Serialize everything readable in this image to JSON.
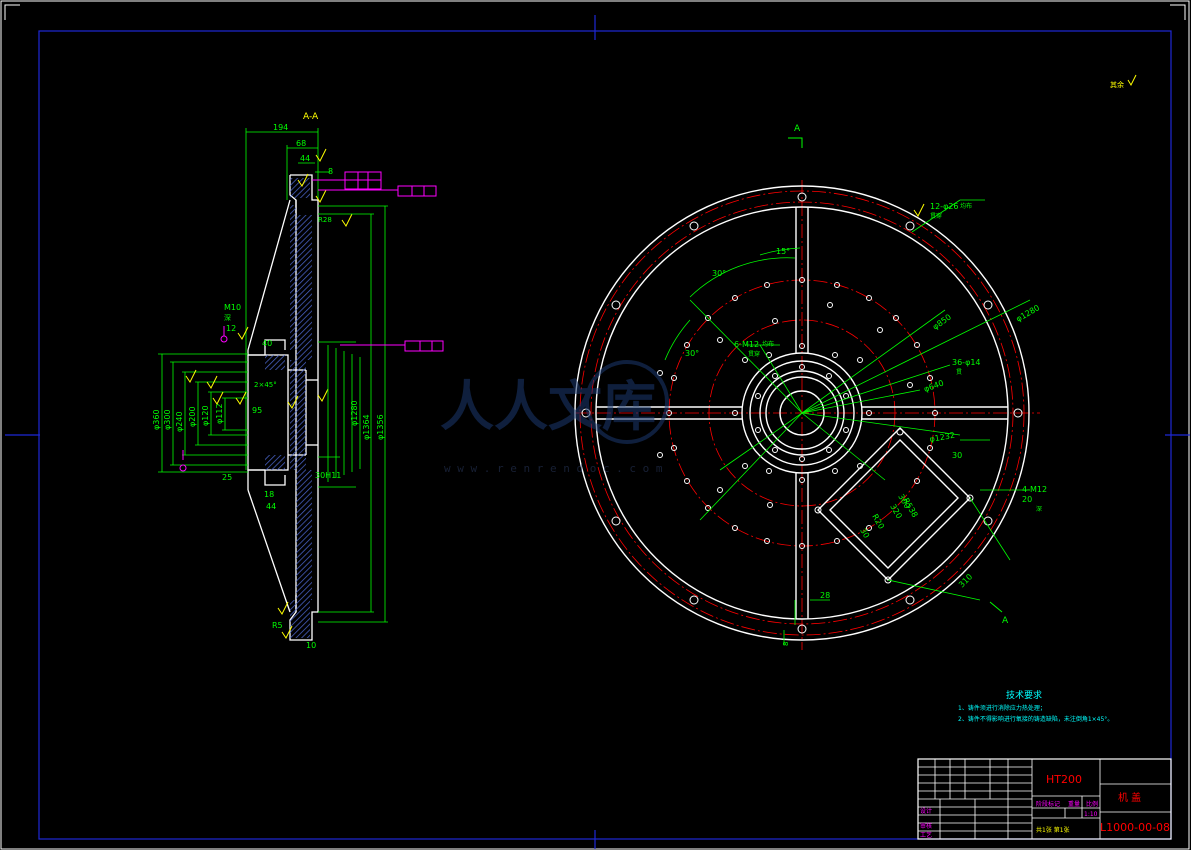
{
  "section_view": {
    "title": "A-A",
    "dims_top": [
      "194",
      "68",
      "44",
      "8"
    ],
    "dim_r28": "R28",
    "thread_note": "M10",
    "thread_note2": "深",
    "chamfer_note": "12",
    "dim_40": "40",
    "dim_chamfer": "2×45°",
    "dims_left_dia": [
      "φ360",
      "φ300",
      "φ240",
      "φ200",
      "φ120",
      "φ112"
    ],
    "dim_95": "95",
    "dim_25": "25",
    "dim_18": "18",
    "dim_44b": "44",
    "dim_30h11": "30H11",
    "dim_r5": "R5",
    "dim_10": "10",
    "dims_right_dia": [
      "φ1356",
      "φ1364",
      "φ1280"
    ]
  },
  "plan_view": {
    "section_mark_top": "A",
    "section_mark_bottom": "A",
    "note_holes_26": "12-φ26",
    "note_holes_26_b": "均布",
    "note_holes_26_c": "贯穿",
    "angle_15": "15°",
    "angle_30a": "30°",
    "angle_30b": "30°",
    "note_m12_a": "6-M12",
    "note_m12_a2": "均布",
    "note_m12_a3": "贯穿",
    "dia_850": "φ850",
    "dia_1280": "φ1280",
    "holes_14": "36-φ14",
    "holes_14_b": "贯",
    "dia_640": "φ640",
    "dia_1232": "φ1232",
    "dim_30": "30",
    "dim_1538": "R538",
    "dim_300": "300",
    "dim_320": "320",
    "dim_r20": "R20",
    "note_m12_b": "4-M12",
    "note_m12_b2": "20",
    "note_m12_b3": "深",
    "dim_30b": "30",
    "dim_310": "310",
    "dim_28": "28",
    "dim_8": "8"
  },
  "roughness_other": "其余",
  "tech_requirements": {
    "title": "技术要求",
    "items": [
      "1、铸件须进行消除应力热处理；",
      "2、铸件不得影响进行氧接的铸造缺陷，未注倒角1×45°。"
    ]
  },
  "title_block": {
    "material": "HT200",
    "part_name": "机 盖",
    "drawing_no": "L1000-00-08",
    "scale_label": "1:10",
    "sheet_label": "共1张 第1张",
    "row_labels": [
      "设计",
      "审核",
      "工艺"
    ],
    "mid_labels": [
      "阶段标记",
      "重量",
      "比例"
    ]
  },
  "watermark": {
    "logo_text": "人人文库",
    "url": "w w w . r e n r e n d o c . c o m"
  },
  "colors": {
    "background": "#000000",
    "outline": "#ffffff",
    "dimension": "#00ff00",
    "text_yellow": "#ffff00",
    "centerline": "#ff0000",
    "magenta": "#ff00ff",
    "blue_frame": "#1e28d6",
    "cyan": "#00ffff"
  }
}
